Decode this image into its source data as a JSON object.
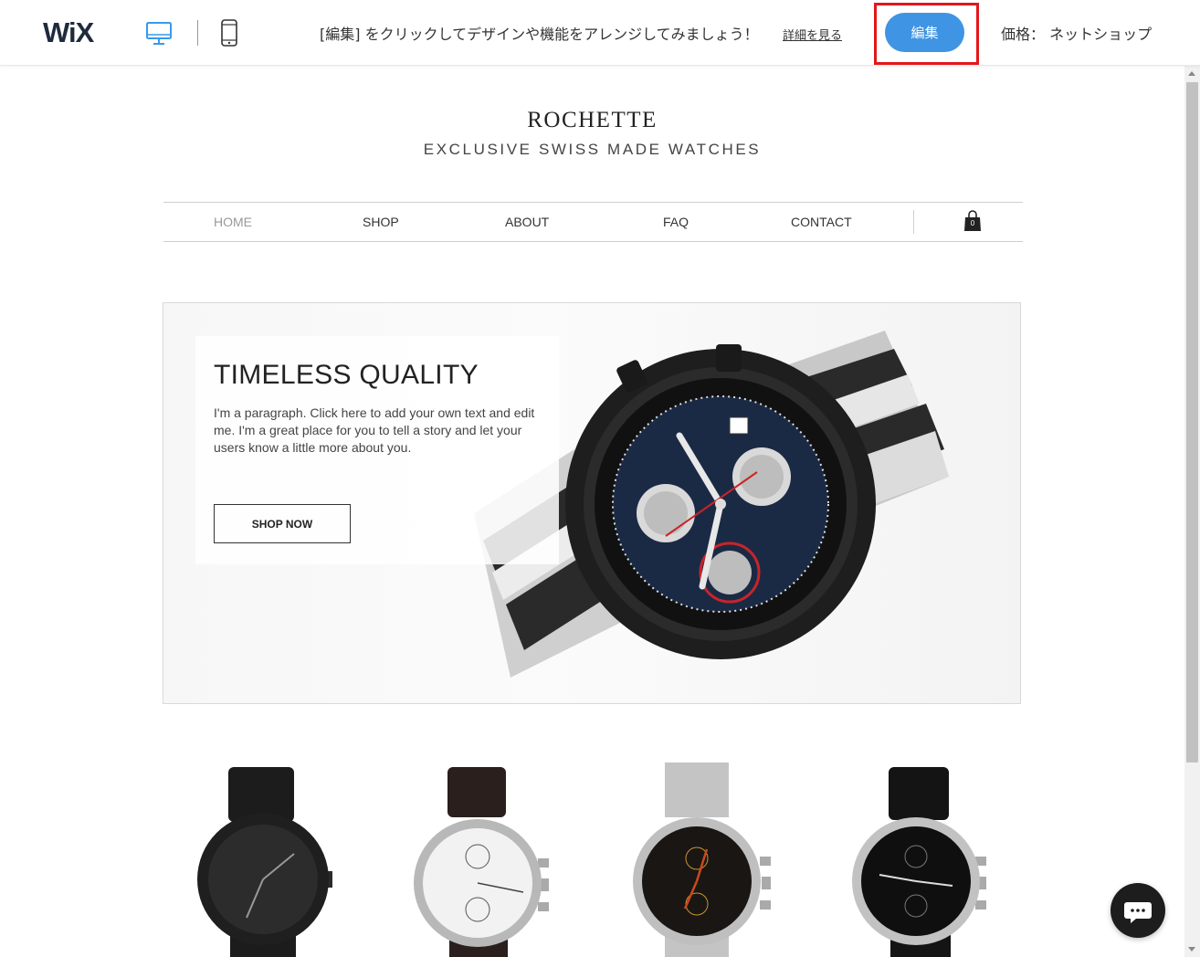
{
  "topbar": {
    "logo": "WiX",
    "desktop_icon": "desktop-monitor-icon",
    "mobile_icon": "mobile-phone-icon",
    "promo_text": "[編集] をクリックしてデザインや機能をアレンジしてみましょう！",
    "promo_link": "詳細を見る",
    "edit_label": "編集",
    "price_label": "価格： ネットショップ",
    "desktop_active_color": "#3899ec",
    "edit_color": "#3f94e3",
    "highlight_color": "#e4161a"
  },
  "site": {
    "title": "ROCHETTE",
    "tagline": "EXCLUSIVE SWISS MADE WATCHES"
  },
  "nav": {
    "items": [
      {
        "label": "HOME",
        "active": true
      },
      {
        "label": "SHOP",
        "active": false
      },
      {
        "label": "ABOUT",
        "active": false
      },
      {
        "label": "FAQ",
        "active": false
      },
      {
        "label": "CONTACT",
        "active": false
      }
    ],
    "cart_icon": "shopping-bag-icon",
    "cart_count": "0"
  },
  "hero": {
    "title": "TIMELESS QUALITY",
    "paragraph": "I'm a paragraph. Click here to add your own text and edit me. I'm a great place for you to tell a story and let your users know a little more about you.",
    "button_label": "SHOP NOW",
    "image": "chronograph-watch-image"
  },
  "products": [
    {
      "image": "black-watch-image"
    },
    {
      "image": "white-chronograph-watch-image"
    },
    {
      "image": "steel-chronograph-watch-image"
    },
    {
      "image": "black-dial-chronograph-watch-image"
    }
  ],
  "chat": {
    "icon": "chat-bubble-icon"
  }
}
